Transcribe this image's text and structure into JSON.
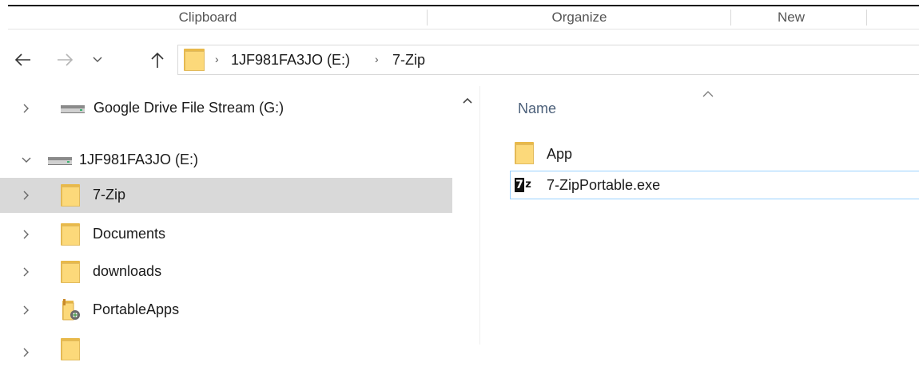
{
  "ribbon": {
    "groups": [
      {
        "label": "Clipboard"
      },
      {
        "label": "Organize"
      },
      {
        "label": "New"
      }
    ]
  },
  "navigation": {
    "back": "back-arrow",
    "forward": "forward-arrow",
    "recent": "chevron-down",
    "up": "up-arrow"
  },
  "address_bar": {
    "folder_icon": "folder-icon",
    "crumbs": [
      {
        "label": "1JF981FA3JO (E:)"
      },
      {
        "label": "7-Zip"
      }
    ]
  },
  "nav_pane": {
    "items": [
      {
        "label": "Google Drive File Stream (G:)",
        "icon": "drive-icon",
        "expanded": false,
        "selected": false
      },
      {
        "label": "1JF981FA3JO (E:)",
        "icon": "drive-icon",
        "expanded": true,
        "selected": false
      },
      {
        "label": "7-Zip",
        "icon": "folder-icon",
        "expanded": false,
        "selected": true
      },
      {
        "label": "Documents",
        "icon": "folder-icon",
        "expanded": false,
        "selected": false
      },
      {
        "label": "downloads",
        "icon": "folder-icon",
        "expanded": false,
        "selected": false
      },
      {
        "label": "PortableApps",
        "icon": "portableapps-folder-icon",
        "expanded": false,
        "selected": false
      }
    ]
  },
  "content": {
    "column_header": "Name",
    "sort": "ascending",
    "files": [
      {
        "name": "App",
        "icon": "folder-icon",
        "focused": false
      },
      {
        "name": "7-ZipPortable.exe",
        "icon": "7zip-icon",
        "focused": true
      }
    ]
  },
  "colors": {
    "selected_row": "#d9d9d9",
    "focus_border": "#99d1ff",
    "header_text": "#4c607a",
    "folder_yellow": "#fcd97a"
  }
}
